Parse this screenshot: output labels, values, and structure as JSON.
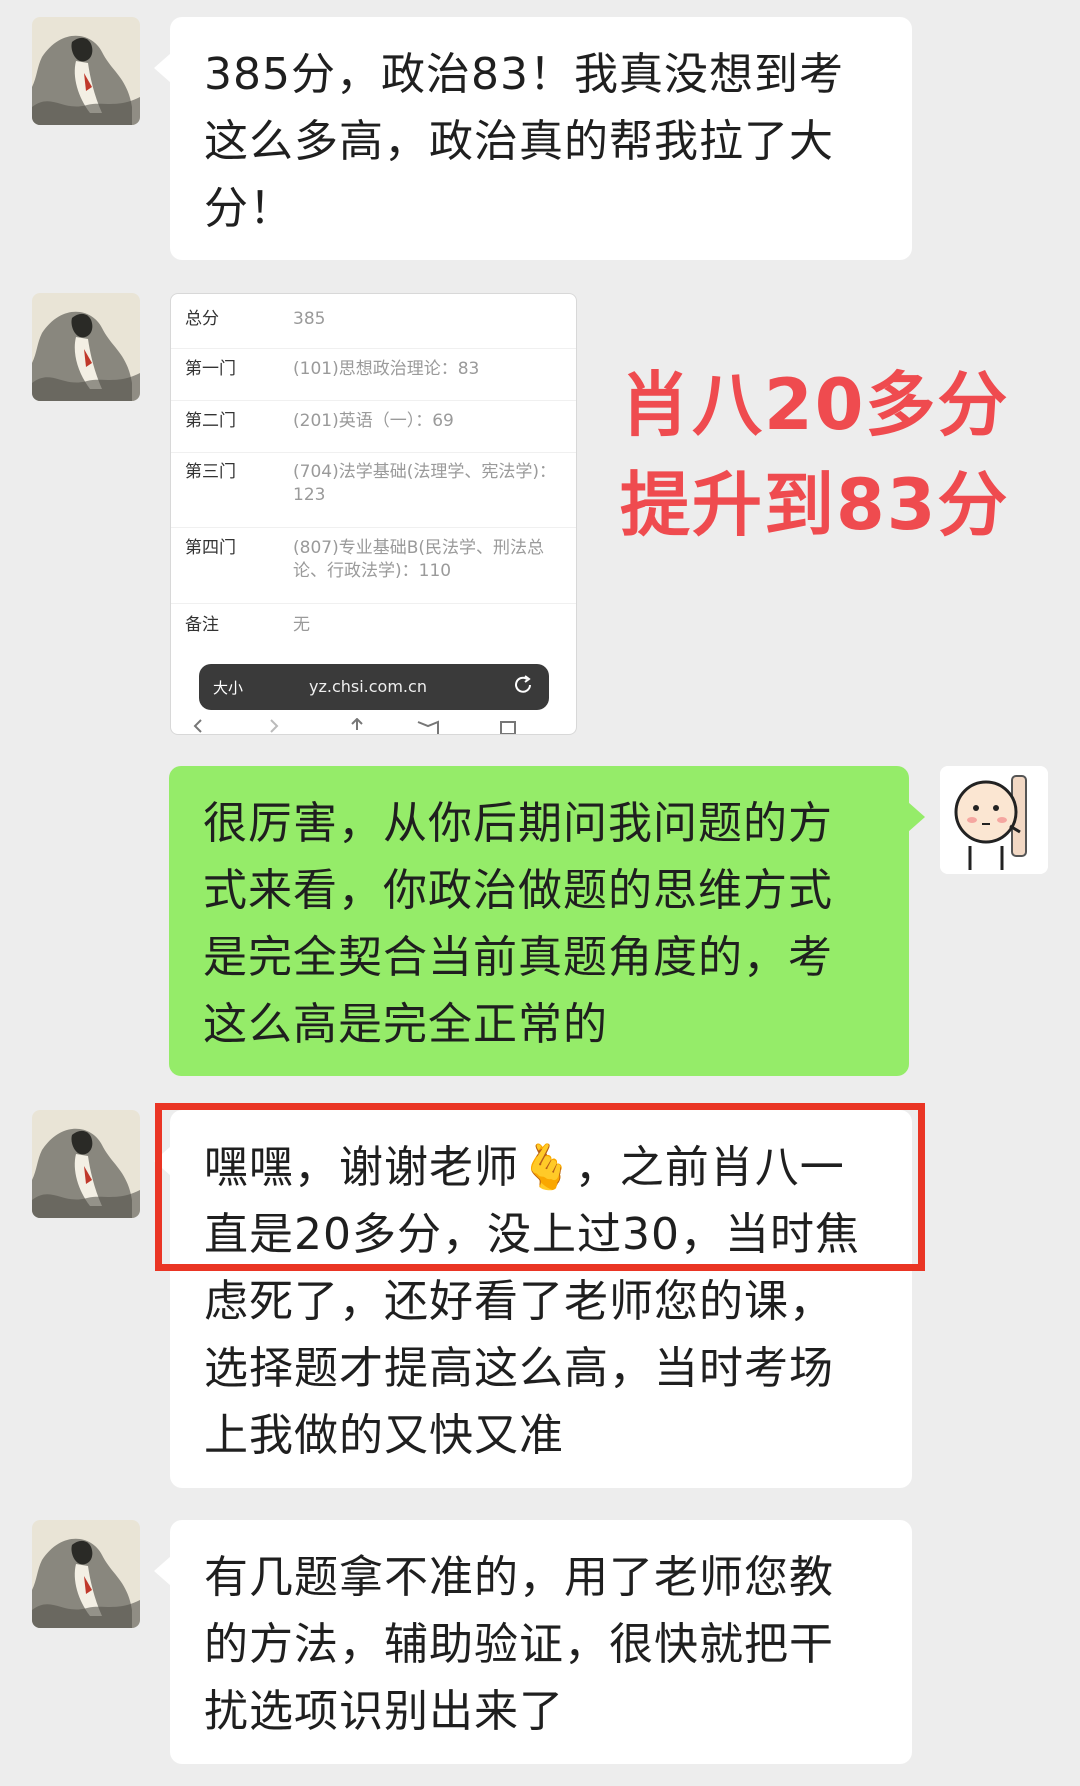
{
  "messages": [
    {
      "side": "left",
      "text": "385分，政治83！我真没想到考这么多高，政治真的帮我拉了大分！"
    },
    {
      "side": "right",
      "text": "很厉害，从你后期问我问题的方式来看，你政治做题的思维方式是完全契合当前真题角度的，考这么高是完全正常的"
    },
    {
      "side": "left",
      "text": "嘿嘿，谢谢老师🫰，之前肖八一直是20多分，没上过30，当时焦虑死了，还好看了老师您的课，选择题才提高这么高，当时考场上我做的又快又准"
    },
    {
      "side": "left",
      "text": "有几题拿不准的，用了老师您教的方法，辅助验证，很快就把干扰选项识别出来了"
    }
  ],
  "score_card": {
    "rows": [
      {
        "label": "总分",
        "value": "385"
      },
      {
        "label": "第一门",
        "value": "(101)思想政治理论：83"
      },
      {
        "label": "第二门",
        "value": "(201)英语（一）：69"
      },
      {
        "label": "第三门",
        "value": "(704)法学基础(法理学、宪法学)：123"
      },
      {
        "label": "第四门",
        "value": "(807)专业基础B(民法学、刑法总论、行政法学)：110"
      },
      {
        "label": "备注",
        "value": "无"
      }
    ],
    "size_label": "大小",
    "url": "yz.chsi.com.cn"
  },
  "caption": {
    "line1": "肖八20多分",
    "line2": "提升到83分"
  },
  "colors": {
    "background": "#ededed",
    "bubble_left": "#ffffff",
    "bubble_right": "#95ec69",
    "caption_red": "#ef4b4f",
    "highlight_red": "#ea3524"
  }
}
